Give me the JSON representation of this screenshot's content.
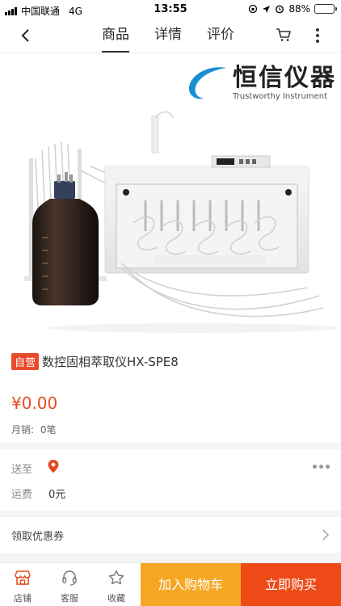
{
  "status_bar": {
    "carrier": "中国联通",
    "network": "4G",
    "time": "13:55",
    "battery_pct": "88%",
    "battery_level": 0.88,
    "battery_color": "#f0c419"
  },
  "nav": {
    "tabs": [
      {
        "label": "商品",
        "active": true
      },
      {
        "label": "详情",
        "active": false
      },
      {
        "label": "评价",
        "active": false
      }
    ],
    "back_icon": "chevron-left-icon",
    "cart_icon": "cart-icon",
    "more_icon": "more-vertical-icon"
  },
  "product_image": {
    "brand_name": "恒信仪器",
    "brand_tagline": "Trustworthy Instrument",
    "brand_color": "#1a8fd0"
  },
  "product": {
    "badge": "自营",
    "title": "数控固相萃取仪HX-SPE8",
    "price": "¥0.00",
    "sales_label": "月销:",
    "sales_value": "0笔"
  },
  "delivery": {
    "ship_to_label": "送至",
    "freight_label": "运费",
    "freight_value": "0元",
    "pin_icon": "location-pin-icon",
    "more_icon": "more-horizontal-icon"
  },
  "coupon": {
    "label": "领取优惠券",
    "chevron_icon": "chevron-right-icon"
  },
  "bottom_bar": {
    "store_label": "店铺",
    "service_label": "客服",
    "favorite_label": "收藏",
    "add_to_cart_label": "加入购物车",
    "buy_now_label": "立即购买",
    "add_to_cart_color": "#f5a623",
    "buy_now_color": "#ee4a18"
  }
}
